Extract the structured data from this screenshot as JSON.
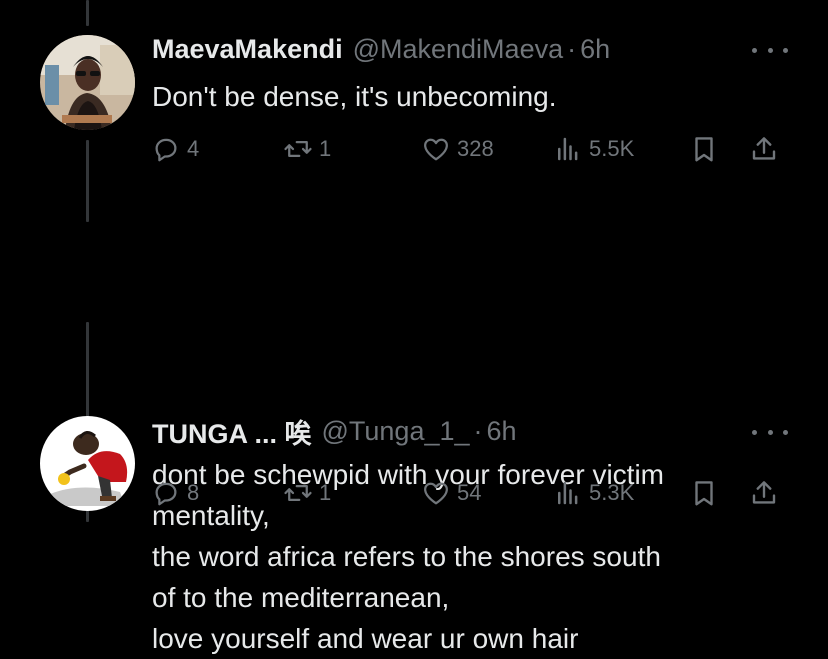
{
  "tweets": [
    {
      "name": "MaevaMakendi",
      "handle": "@MakendiMaeva",
      "separator": "·",
      "time": "6h",
      "text_lines": [
        "Don't be dense, it's unbecoming."
      ],
      "replies": "4",
      "retweets": "1",
      "likes": "328",
      "views": "5.5K"
    },
    {
      "name": "TUNGA ... 唉",
      "handle": "@Tunga_1_",
      "separator": "·",
      "time": "6h",
      "text_lines": [
        "dont be schewpid with your forever victim",
        "mentality,",
        "the word africa refers to the shores south",
        "of to the mediterranean,",
        "love yourself and wear ur own hair"
      ],
      "replies": "8",
      "retweets": "1",
      "likes": "54",
      "views": "5.3K"
    }
  ],
  "icons": {
    "reply": "reply-icon",
    "retweet": "retweet-icon",
    "like": "heart-icon",
    "views": "views-icon",
    "bookmark": "bookmark-icon",
    "share": "share-icon",
    "more": "more-icon"
  },
  "colors": {
    "background": "#000000",
    "text": "#e7e9ea",
    "secondary": "#71767b",
    "thread_line": "#333639"
  }
}
